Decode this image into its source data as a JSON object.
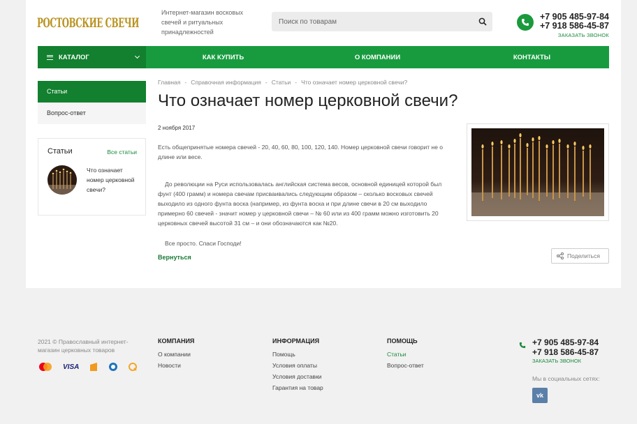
{
  "header": {
    "logo_text": "РОСТОВСКИЕ СВЕЧИ",
    "tagline": "Интернет-магазин восковых свечей и ритуальных принадлежностей",
    "search_placeholder": "Поиск по товарам",
    "phone1": "+7 905 485-97-84",
    "phone2": "+7 918 586-45-87",
    "callback": "ЗАКАЗАТЬ ЗВОНОК"
  },
  "nav": {
    "catalog": "КАТАЛОГ",
    "items": [
      "КАК КУПИТЬ",
      "О КОМПАНИИ",
      "КОНТАКТЫ"
    ]
  },
  "sidebar": {
    "menu": [
      "Статьи",
      "Вопрос-ответ"
    ],
    "box_title": "Статьи",
    "box_all": "Все статьи",
    "box_article": "Что означает номер церковной свечи?"
  },
  "breadcrumb": [
    "Главная",
    "Справочная информация",
    "Статьи",
    "Что означает номер церковной свечи?"
  ],
  "article": {
    "title": "Что означает номер церковной свечи?",
    "date": "2 ноября 2017",
    "p1": "Есть общепринятые номера свечей - 20, 40, 60, 80, 100, 120, 140. Номер церковной свечи говорит не о длине или весе.",
    "p2": "До революции на Руси использовалась английская система весов, основной единицей которой был фунт (400 грамм) и номера свечам присваивались следующим образом – сколько восковых свечей выходило из одного фунта воска (например, из фунта воска и при длине свечи в 20 см выходило примерно 60 свечей - значит номер у церковной свечи – № 60 или из 400 грамм можно изготовить 20 церковных свечей высотой 31 см – и они обозначаются как №20.",
    "p3": "Все просто. Спаси Господи!",
    "back": "Вернуться",
    "share": "Поделиться"
  },
  "footer": {
    "copyright": "2021 © Православный интернет-магазин церковных товаров",
    "payments": [
      "mastercard-icon",
      "visa-icon",
      "yandex-money-icon",
      "webmoney-icon",
      "qiwi-icon"
    ],
    "visa_text": "VISA",
    "columns": [
      {
        "title": "КОМПАНИЯ",
        "links": [
          "О компании",
          "Новости"
        ]
      },
      {
        "title": "ИНФОРМАЦИЯ",
        "links": [
          "Помощь",
          "Условия оплаты",
          "Условия доставки",
          "Гарантия на товар"
        ]
      },
      {
        "title": "ПОМОЩЬ",
        "links": [
          "Статьи",
          "Вопрос-ответ"
        ]
      }
    ],
    "phone1": "+7 905 485-97-84",
    "phone2": "+7 918 586-45-87",
    "callback": "ЗАКАЗАТЬ ЗВОНОК",
    "social_label": "Мы в социальных сетях:",
    "vk": "vk"
  },
  "colors": {
    "brand_green": "#189b3f",
    "dark_green": "#12802f",
    "logo_gold": "#b99320"
  }
}
